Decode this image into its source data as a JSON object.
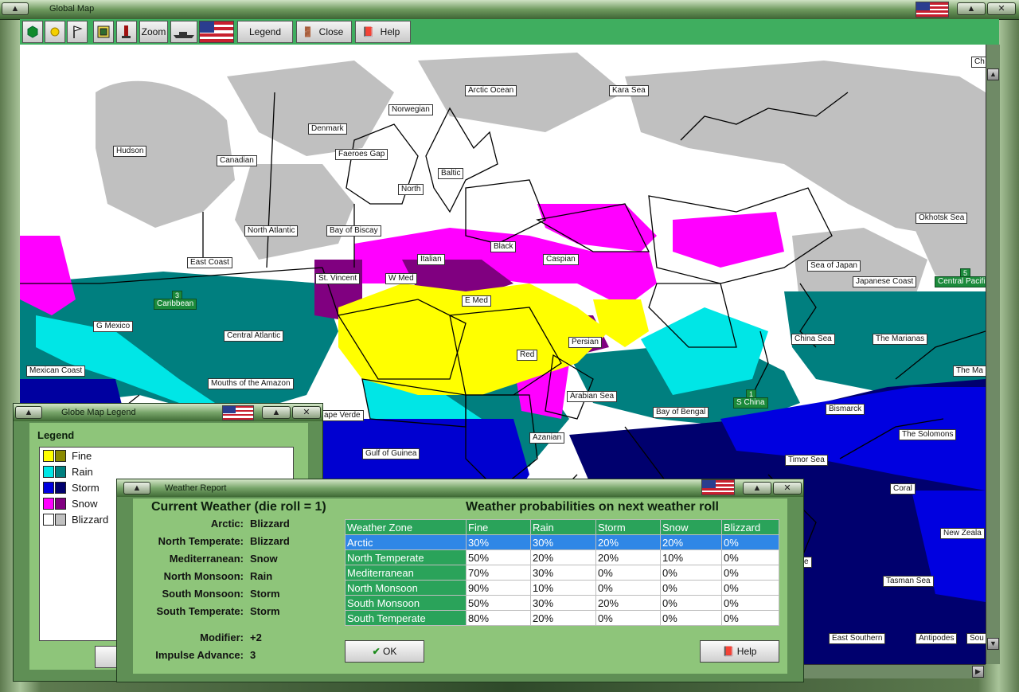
{
  "app": {
    "title": "Global Map"
  },
  "toolbar": {
    "zoom_label": "Zoom",
    "legend_label": "Legend",
    "close_label": "Close",
    "help_label": "Help"
  },
  "map_labels": {
    "arctic_ocean": "Arctic Ocean",
    "kara_sea": "Kara Sea",
    "norwegian": "Norwegian",
    "denmark": "Denmark",
    "faeroes_gap": "Faeroes Gap",
    "baltic": "Baltic",
    "north": "North",
    "hudson": "Hudson",
    "canadian": "Canadian",
    "north_atlantic": "North Atlantic",
    "bay_of_biscay": "Bay of Biscay",
    "east_coast": "East Coast",
    "black": "Black",
    "italian": "Italian",
    "caspian": "Caspian",
    "st_vincent": "St. Vincent",
    "w_med": "W Med",
    "e_med": "E Med",
    "persian": "Persian",
    "red": "Red",
    "arabian_sea": "Arabian Sea",
    "bay_of_bengal": "Bay of Bengal",
    "g_mexico": "G Mexico",
    "central_atlantic": "Central Atlantic",
    "mexican_coast": "Mexican Coast",
    "mouths_amazon": "Mouths of the Amazon",
    "cape_verde": "ape Verde",
    "gulf_of_guinea": "Gulf of Guinea",
    "azanian": "Azanian",
    "okhotsk_sea": "Okhotsk Sea",
    "sea_of_japan": "Sea of Japan",
    "japanese_coast": "Japanese Coast",
    "china_sea": "China Sea",
    "the_marianas": "The Marianas",
    "the_ma": "The Ma",
    "bismarck": "Bismarck",
    "the_solomons": "The Solomons",
    "timor_sea": "Timor Sea",
    "coral": "Coral",
    "new_zeala": "New Zeala",
    "tasman_sea": "Tasman Sea",
    "east_southern": "East Southern",
    "antipodes": "Antipodes",
    "sou": "Sou",
    "ch": "Ch",
    "e_partial": "e"
  },
  "zones": {
    "caribbean": {
      "num": "3",
      "label": "Caribbean"
    },
    "s_china": {
      "num": "1",
      "label": "S China"
    },
    "central_pacific": {
      "num": "5",
      "label": "Central Pacifi"
    }
  },
  "legend_window": {
    "title": "Globe Map Legend",
    "heading": "Legend",
    "items": [
      {
        "label": "Fine",
        "color1": "#ffff00",
        "color2": "#8a8a00"
      },
      {
        "label": "Rain",
        "color1": "#00e6e6",
        "color2": "#007f7f"
      },
      {
        "label": "Storm",
        "color1": "#0000e0",
        "color2": "#00006e"
      },
      {
        "label": "Snow",
        "color1": "#ff00ff",
        "color2": "#800080"
      },
      {
        "label": "Blizzard",
        "color1": "#ffffff",
        "color2": "#c0c0c0"
      }
    ]
  },
  "weather_window": {
    "title": "Weather Report",
    "current_heading": "Current Weather (die roll = 1)",
    "prob_heading": "Weather probabilities on next weather roll",
    "current": [
      {
        "label": "Arctic:",
        "value": "Blizzard"
      },
      {
        "label": "North Temperate:",
        "value": "Blizzard"
      },
      {
        "label": "Mediterranean:",
        "value": "Snow"
      },
      {
        "label": "North Monsoon:",
        "value": "Rain"
      },
      {
        "label": "South Monsoon:",
        "value": "Storm"
      },
      {
        "label": "South Temperate:",
        "value": "Storm"
      }
    ],
    "modifier_label": "Modifier:",
    "modifier_value": "+2",
    "impulse_label": "Impulse Advance:",
    "impulse_value": "3",
    "table_headers": [
      "Weather Zone",
      "Fine",
      "Rain",
      "Storm",
      "Snow",
      "Blizzard"
    ],
    "table_rows": [
      [
        "Arctic",
        "30%",
        "30%",
        "20%",
        "20%",
        "0%"
      ],
      [
        "North Temperate",
        "50%",
        "20%",
        "20%",
        "10%",
        "0%"
      ],
      [
        "Mediterranean",
        "70%",
        "30%",
        "0%",
        "0%",
        "0%"
      ],
      [
        "North Monsoon",
        "90%",
        "10%",
        "0%",
        "0%",
        "0%"
      ],
      [
        "South Monsoon",
        "50%",
        "30%",
        "20%",
        "0%",
        "0%"
      ],
      [
        "South Temperate",
        "80%",
        "20%",
        "0%",
        "0%",
        "0%"
      ]
    ],
    "ok_label": "OK",
    "help_label": "Help"
  }
}
